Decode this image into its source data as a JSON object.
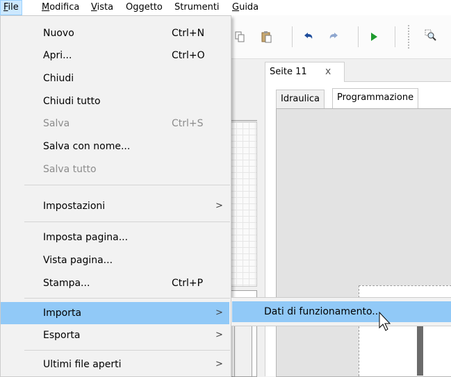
{
  "menubar": {
    "items": [
      {
        "label": "File",
        "mnemonic": "F",
        "rest": "ile",
        "active": true
      },
      {
        "label": "Modifica",
        "mnemonic": "M",
        "rest": "odifica"
      },
      {
        "label": "Vista",
        "mnemonic": "V",
        "rest": "ista"
      },
      {
        "label": "Oggetto",
        "mnemonic": "",
        "rest": "Oggetto"
      },
      {
        "label": "Strumenti",
        "mnemonic": "",
        "rest": "Strumenti"
      },
      {
        "label": "Guida",
        "mnemonic": "G",
        "rest": "uida"
      }
    ]
  },
  "toolbar": {
    "icons": [
      "copy-icon",
      "paste-icon",
      "undo-icon",
      "redo-icon",
      "play-icon",
      "zoom-icon"
    ],
    "colors": {
      "undo": "#1f4e9c",
      "redo": "#8fa7cf",
      "play": "#1e9b2e"
    }
  },
  "document": {
    "tab_label": "Seite 11",
    "tab_close": "x",
    "subtabs": [
      {
        "label": "Idraulica",
        "active": false
      },
      {
        "label": "Programmazione",
        "active": true
      }
    ]
  },
  "file_menu": {
    "items": [
      {
        "label": "Nuovo",
        "shortcut": "Ctrl+N"
      },
      {
        "label": "Apri...",
        "shortcut": "Ctrl+O"
      },
      {
        "label": "Chiudi",
        "shortcut": ""
      },
      {
        "label": "Chiudi tutto",
        "shortcut": ""
      },
      {
        "label": "Salva",
        "shortcut": "Ctrl+S",
        "disabled": true
      },
      {
        "label": "Salva con nome...",
        "shortcut": ""
      },
      {
        "label": "Salva tutto",
        "shortcut": "",
        "disabled": true
      },
      {
        "label": "Impostazioni",
        "shortcut": "",
        "submenu": true
      },
      {
        "label": "Imposta pagina...",
        "shortcut": ""
      },
      {
        "label": "Vista pagina...",
        "shortcut": ""
      },
      {
        "label": "Stampa...",
        "shortcut": "Ctrl+P"
      },
      {
        "label": "Importa",
        "shortcut": "",
        "submenu": true,
        "highlighted": true
      },
      {
        "label": "Esporta",
        "shortcut": "",
        "submenu": true
      },
      {
        "label": "Ultimi file aperti",
        "shortcut": "",
        "submenu": true
      }
    ],
    "submenu_arrow": ">"
  },
  "import_submenu": {
    "items": [
      {
        "label": "Dati di funzionamento...",
        "highlighted": true
      }
    ]
  },
  "colors": {
    "highlight": "#91c9f7",
    "menubar_active": "#cce8ff"
  }
}
